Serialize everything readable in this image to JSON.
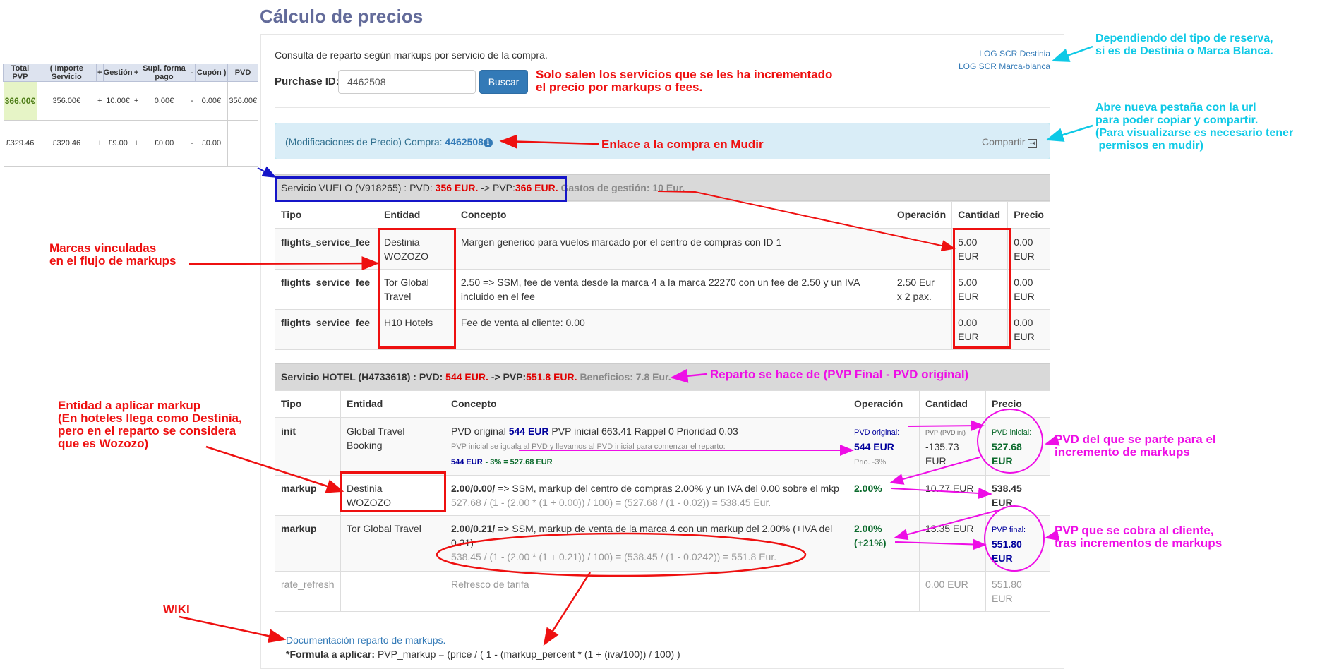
{
  "page_title": "Cálculo de precios",
  "mini_table": {
    "headers": [
      "Total PVP",
      "( Importe Servicio",
      "+",
      "Gestión",
      "+",
      "Supl. forma pago",
      "-",
      "Cupón )",
      "PVD"
    ],
    "rows": [
      [
        "366.00€",
        "356.00€",
        "+",
        "10.00€",
        "+",
        "0.00€",
        "-",
        "0.00€",
        "356.00€"
      ],
      [
        "£329.46",
        "£320.46",
        "+",
        "£9.00",
        "+",
        "£0.00",
        "-",
        "£0.00",
        ""
      ]
    ]
  },
  "intro_text": "Consulta de reparto según markups por servicio de la compra.",
  "purchase": {
    "label": "Purchase ID:",
    "value": "4462508",
    "search_button": "Buscar"
  },
  "log_links": [
    "LOG SCR Destinia",
    "LOG SCR Marca-blanca"
  ],
  "alert": {
    "prefix": "(Modificaciones de Precio) Compra:",
    "purchase_id": "4462508",
    "info_icon": "i",
    "share_label": "Compartir",
    "share_icon": "⇥"
  },
  "vuelo": {
    "title": "Servicio VUELO (V918265) : PVD:",
    "pvd": "356 EUR.",
    "arrow": "-> PVP:",
    "pvp": "366 EUR.",
    "gastos_label": "Gastos de gestión:",
    "gastos": "10 Eur.",
    "headers": [
      "Tipo",
      "Entidad",
      "Concepto",
      "Operación",
      "Cantidad",
      "Precio"
    ],
    "rows": [
      {
        "tipo": "flights_service_fee",
        "entidad_1": "Destinia",
        "entidad_2": "WOZOZO",
        "concepto": "Margen generico para vuelos marcado por el centro de compras con ID 1",
        "operacion_1": "",
        "operacion_2": "",
        "cantidad_1": "5.00",
        "cantidad_2": "EUR",
        "precio_1": "0.00",
        "precio_2": "EUR"
      },
      {
        "tipo": "flights_service_fee",
        "entidad_1": "Tor Global",
        "entidad_2": "Travel",
        "concepto": "2.50 => SSM, fee de venta desde la marca 4 a la marca 22270 con un fee de 2.50 y un IVA incluido en el fee",
        "operacion_1": "2.50 Eur",
        "operacion_2": "x 2 pax.",
        "cantidad_1": "5.00",
        "cantidad_2": "EUR",
        "precio_1": "0.00",
        "precio_2": "EUR"
      },
      {
        "tipo": "flights_service_fee",
        "entidad_1": "H10 Hotels",
        "entidad_2": "",
        "concepto": "Fee de venta al cliente: 0.00",
        "operacion_1": "",
        "operacion_2": "",
        "cantidad_1": "0.00",
        "cantidad_2": "EUR",
        "precio_1": "0.00",
        "precio_2": "EUR"
      }
    ]
  },
  "hotel": {
    "title": "Servicio HOTEL (H4733618) : PVD:",
    "pvd": "544 EUR.",
    "arrow": "-> PVP:",
    "pvp": "551.8 EUR.",
    "beneficios": "Beneficios: 7.8 Eur.",
    "headers": [
      "Tipo",
      "Entidad",
      "Concepto",
      "Operación",
      "Cantidad",
      "Precio"
    ],
    "init": {
      "tipo": "init",
      "entidad_1": "Global Travel",
      "entidad_2": "Booking",
      "c_prefix": "PVD original",
      "c_pvd": "544 EUR",
      "c_rest": "PVP inicial 663.41 Rappel 0 Prioridad 0.03",
      "c_note": "PVP inicial se iguala al PVD y llevamos al PVD inicial para comenzar el reparto:",
      "c_calc_a": "544 EUR",
      "c_calc_b": "- 3% = 527.68 EUR",
      "op_label": "PVD original:",
      "op_value": "544 EUR",
      "op_note": "Prio. -3%",
      "cant_label": "PVP-(PVD ini)",
      "cant_value": "-135.73",
      "cant_unit": "EUR",
      "precio_label": "PVD inicial:",
      "precio_value": "527.68",
      "precio_unit": "EUR"
    },
    "markup1": {
      "tipo": "markup",
      "entidad_1": "Destinia",
      "entidad_2": "WOZOZO",
      "c_bold": "2.00/0.00/",
      "c_text": "=> SSM, markup del centro de compras 2.00% y un IVA del 0.00 sobre el mkp",
      "c_formula": "527.68 / (1 - (2.00 * (1 + 0.00)) / 100) = (527.68 / (1 - 0.02)) = 538.45 Eur.",
      "op": "2.00%",
      "cant": "10.77 EUR",
      "precio_1": "538.45",
      "precio_2": "EUR"
    },
    "markup2": {
      "tipo": "markup",
      "entidad": "Tor Global Travel",
      "c_bold": "2.00/0.21/",
      "c_text": "=> SSM, markup de venta de la marca 4 con un markup del 2.00% (+IVA del 0.21)",
      "c_formula": "538.45 / (1 - (2.00 * (1 + 0.21)) / 100) = (538.45 / (1 - 0.0242)) = 551.8 Eur.",
      "op_1": "2.00%",
      "op_2": "(+21%)",
      "cant": "13.35 EUR",
      "precio_label": "PVP final:",
      "precio_value": "551.80",
      "precio_unit": "EUR"
    },
    "refresh": {
      "tipo": "rate_refresh",
      "concepto": "Refresco de tarifa",
      "cant": "0.00 EUR",
      "precio_1": "551.80",
      "precio_2": "EUR"
    }
  },
  "doc_link": "Documentación reparto de markups.",
  "formula_label": "*Formula a aplicar:",
  "formula": "PVP_markup = (price / ( 1 - (markup_percent * (1 + (iva/100)) / 100) )",
  "annotations": {
    "solo_salen": "Solo salen los servicios que se les ha incrementado\nel precio por markups o fees.",
    "enlace": "Enlace a la compra en Mudir",
    "dependiendo": "Dependiendo del tipo de reserva,\nsi es de Destinia o Marca Blanca.",
    "abre": "Abre nueva pestaña con la url\npara poder copiar y compartir.\n(Para visualizarse es necesario tener\n permisos en mudir)",
    "marcas": "Marcas vinculadas\nen el flujo de markups",
    "reparto": "Reparto se hace de (PVP Final - PVD original)",
    "entidad": "Entidad a aplicar markup\n(En hoteles llega como Destinia,\npero en el reparto se considera\nque es Wozozo)",
    "pvd_parte": "PVD del que se parte para el\nincremento de markups",
    "pvp_cobra": "PVP que se cobra al cliente,\ntras incrementos de markups",
    "wiki": "WIKI"
  },
  "colors": {
    "annotation_red": "#ee1010",
    "annotation_cyan": "#0fc9e6",
    "annotation_magenta": "#ee0ee6",
    "link_blue": "#337ab7",
    "title_purple": "#636b9a"
  }
}
